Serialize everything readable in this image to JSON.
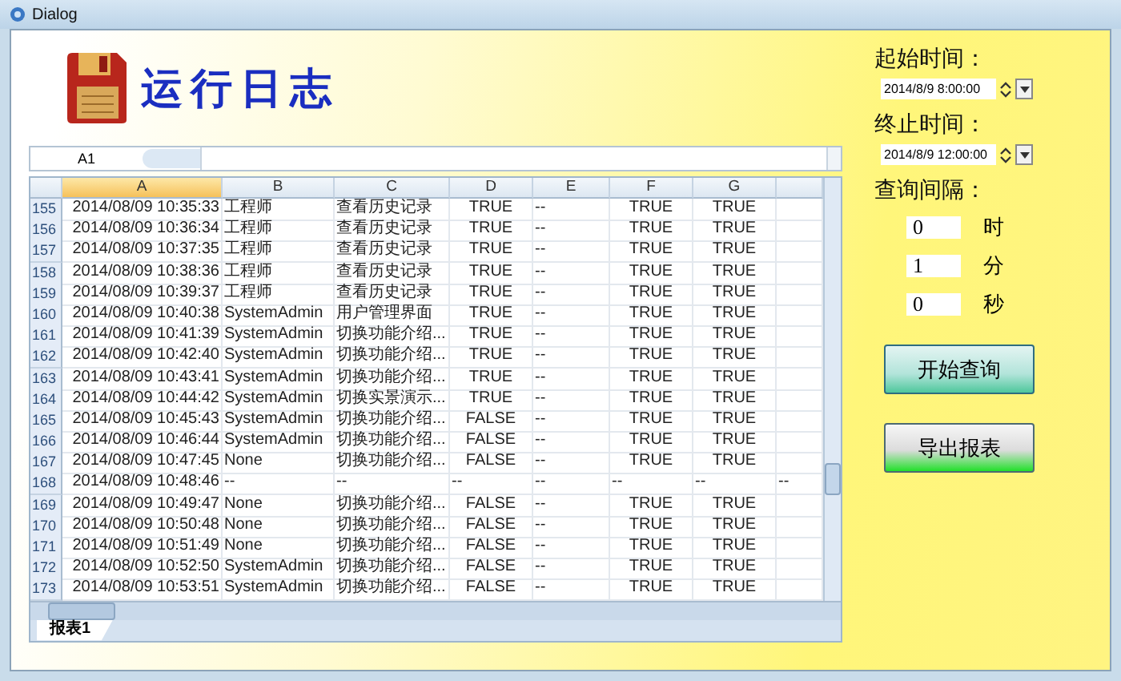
{
  "window": {
    "title": "Dialog"
  },
  "header": {
    "title": "运行日志"
  },
  "name_box": "A1",
  "columns": [
    {
      "label": "A",
      "selected": true
    },
    {
      "label": "B",
      "selected": false
    },
    {
      "label": "C",
      "selected": false
    },
    {
      "label": "D",
      "selected": false
    },
    {
      "label": "E",
      "selected": false
    },
    {
      "label": "F",
      "selected": false
    },
    {
      "label": "G",
      "selected": false
    }
  ],
  "rows": [
    {
      "number": "155",
      "kind": "data",
      "cells": [
        "2014/08/09 10:35:33",
        "工程师",
        "查看历史记录",
        "TRUE",
        "--",
        "TRUE",
        "TRUE"
      ]
    },
    {
      "number": "156",
      "kind": "data",
      "cells": [
        "2014/08/09 10:36:34",
        "工程师",
        "查看历史记录",
        "TRUE",
        "--",
        "TRUE",
        "TRUE"
      ]
    },
    {
      "number": "157",
      "kind": "data",
      "cells": [
        "2014/08/09 10:37:35",
        "工程师",
        "查看历史记录",
        "TRUE",
        "--",
        "TRUE",
        "TRUE"
      ]
    },
    {
      "number": "158",
      "kind": "data",
      "cells": [
        "2014/08/09 10:38:36",
        "工程师",
        "查看历史记录",
        "TRUE",
        "--",
        "TRUE",
        "TRUE"
      ]
    },
    {
      "number": "159",
      "kind": "data",
      "cells": [
        "2014/08/09 10:39:37",
        "工程师",
        "查看历史记录",
        "TRUE",
        "--",
        "TRUE",
        "TRUE"
      ]
    },
    {
      "number": "160",
      "kind": "data",
      "cells": [
        "2014/08/09 10:40:38",
        "SystemAdmin",
        "用户管理界面",
        "TRUE",
        "--",
        "TRUE",
        "TRUE"
      ]
    },
    {
      "number": "161",
      "kind": "data",
      "cells": [
        "2014/08/09 10:41:39",
        "SystemAdmin",
        "切换功能介绍...",
        "TRUE",
        "--",
        "TRUE",
        "TRUE"
      ]
    },
    {
      "number": "162",
      "kind": "data",
      "cells": [
        "2014/08/09 10:42:40",
        "SystemAdmin",
        "切换功能介绍...",
        "TRUE",
        "--",
        "TRUE",
        "TRUE"
      ]
    },
    {
      "number": "163",
      "kind": "data",
      "cells": [
        "2014/08/09 10:43:41",
        "SystemAdmin",
        "切换功能介绍...",
        "TRUE",
        "--",
        "TRUE",
        "TRUE"
      ]
    },
    {
      "number": "164",
      "kind": "data",
      "cells": [
        "2014/08/09 10:44:42",
        "SystemAdmin",
        "切换实景演示...",
        "TRUE",
        "--",
        "TRUE",
        "TRUE"
      ]
    },
    {
      "number": "165",
      "kind": "data",
      "cells": [
        "2014/08/09 10:45:43",
        "SystemAdmin",
        "切换功能介绍...",
        "FALSE",
        "--",
        "TRUE",
        "TRUE"
      ]
    },
    {
      "number": "166",
      "kind": "data",
      "cells": [
        "2014/08/09 10:46:44",
        "SystemAdmin",
        "切换功能介绍...",
        "FALSE",
        "--",
        "TRUE",
        "TRUE"
      ]
    },
    {
      "number": "167",
      "kind": "data",
      "cells": [
        "2014/08/09 10:47:45",
        "None",
        "切换功能介绍...",
        "FALSE",
        "--",
        "TRUE",
        "TRUE"
      ]
    },
    {
      "number": "168",
      "kind": "blank",
      "cells": [
        "2014/08/09 10:48:46",
        "--",
        "--",
        "--",
        "--",
        "--",
        "--",
        "--"
      ]
    },
    {
      "number": "169",
      "kind": "data",
      "cells": [
        "2014/08/09 10:49:47",
        "None",
        "切换功能介绍...",
        "FALSE",
        "--",
        "TRUE",
        "TRUE"
      ]
    },
    {
      "number": "170",
      "kind": "data",
      "cells": [
        "2014/08/09 10:50:48",
        "None",
        "切换功能介绍...",
        "FALSE",
        "--",
        "TRUE",
        "TRUE"
      ]
    },
    {
      "number": "171",
      "kind": "data",
      "cells": [
        "2014/08/09 10:51:49",
        "None",
        "切换功能介绍...",
        "FALSE",
        "--",
        "TRUE",
        "TRUE"
      ]
    },
    {
      "number": "172",
      "kind": "data",
      "cells": [
        "2014/08/09 10:52:50",
        "SystemAdmin",
        "切换功能介绍...",
        "FALSE",
        "--",
        "TRUE",
        "TRUE"
      ]
    },
    {
      "number": "173",
      "kind": "data",
      "cells": [
        "2014/08/09 10:53:51",
        "SystemAdmin",
        "切换功能介绍...",
        "FALSE",
        "--",
        "TRUE",
        "TRUE"
      ]
    }
  ],
  "sheet_tabs": [
    {
      "label": "报表1",
      "selected": true
    }
  ],
  "query": {
    "start_label": "起始时间：",
    "start_value": "2014/8/9 8:00:00",
    "end_label": "终止时间：",
    "end_value": "2014/8/9 12:00:00",
    "interval_label": "查询间隔：",
    "interval": [
      {
        "value": "0",
        "unit": "时"
      },
      {
        "value": "1",
        "unit": "分"
      },
      {
        "value": "0",
        "unit": "秒"
      }
    ]
  },
  "buttons": [
    {
      "label": "开始查询",
      "kind": "query"
    },
    {
      "label": "导出报表",
      "kind": "export"
    }
  ]
}
